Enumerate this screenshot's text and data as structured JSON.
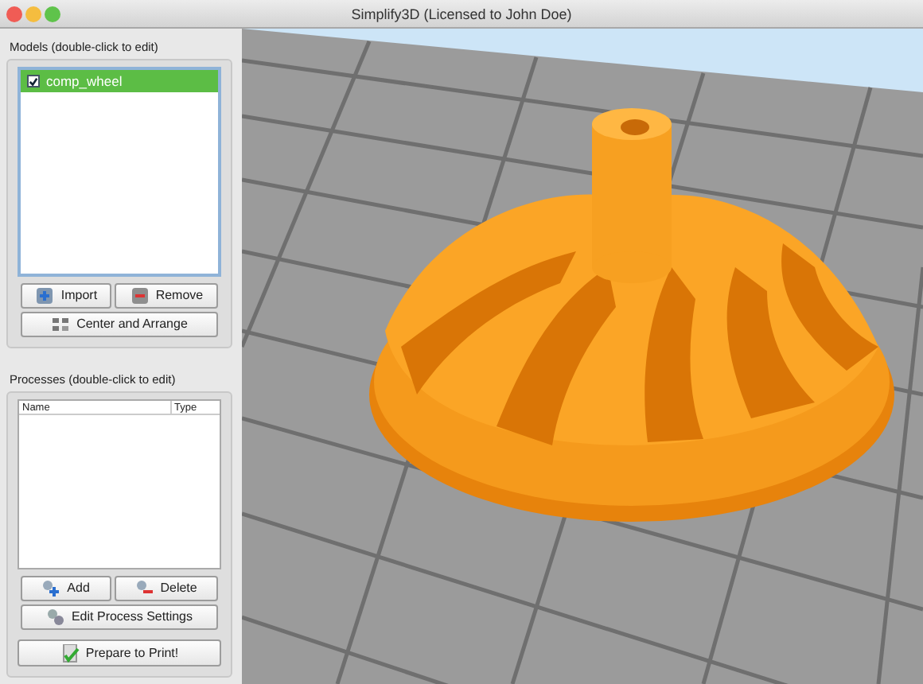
{
  "window": {
    "title": "Simplify3D (Licensed to John Doe)"
  },
  "models": {
    "title": "Models (double-click to edit)",
    "items": [
      {
        "label": "comp_wheel",
        "checked": true,
        "selected": true
      }
    ],
    "buttons": [
      {
        "label": "Import",
        "kind": "import"
      },
      {
        "label": "Remove",
        "kind": "remove"
      },
      {
        "label": "Center and Arrange",
        "kind": "arrange"
      }
    ]
  },
  "processes": {
    "title": "Processes (double-click to edit)",
    "columns": [
      "Name",
      "Type"
    ],
    "buttons": [
      {
        "label": "Add",
        "kind": "add"
      },
      {
        "label": "Delete",
        "kind": "delete"
      },
      {
        "label": "Edit Process Settings",
        "kind": "settings"
      }
    ]
  },
  "prepare_button": {
    "label": "Prepare to Print!"
  }
}
